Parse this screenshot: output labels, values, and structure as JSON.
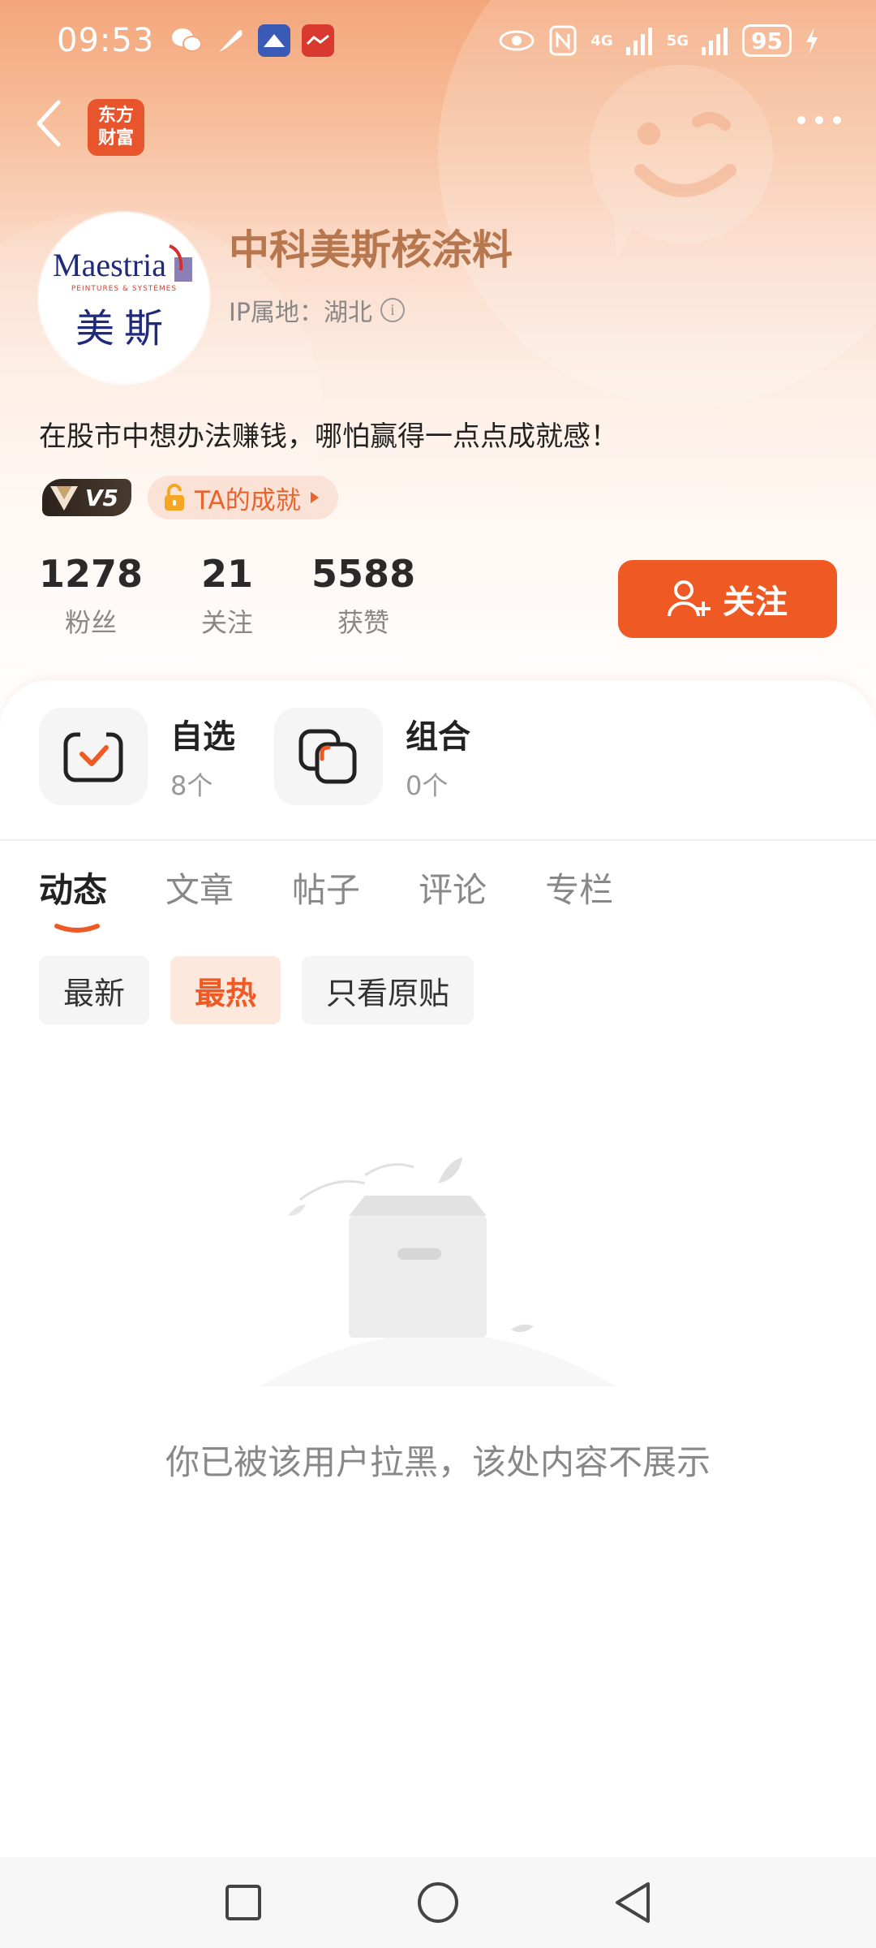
{
  "status_bar": {
    "time": "09:53",
    "battery": "95",
    "net1": "4G",
    "net2": "5G"
  },
  "nav": {
    "logo_line1": "东方",
    "logo_line2": "财富"
  },
  "profile": {
    "name": "中科美斯核涂料",
    "ip_location": "IP属地：湖北",
    "bio": "在股市中想办法赚钱，哪怕赢得一点点成就感！",
    "avatar_brand": "Maestria",
    "avatar_brand_sub": "PEINTURES & SYSTÈMES",
    "avatar_brand_cn": "美斯",
    "vip_level": "V5",
    "achievement_label": "TA的成就"
  },
  "stats": [
    {
      "value": "1278",
      "label": "粉丝"
    },
    {
      "value": "21",
      "label": "关注"
    },
    {
      "value": "5588",
      "label": "获赞"
    }
  ],
  "follow_button": "关注",
  "portfolio": {
    "watchlist": {
      "title": "自选",
      "count": "8个"
    },
    "combo": {
      "title": "组合",
      "count": "0个"
    }
  },
  "tabs": [
    "动态",
    "文章",
    "帖子",
    "评论",
    "专栏"
  ],
  "active_tab": 0,
  "filters": [
    "最新",
    "最热",
    "只看原贴"
  ],
  "active_filter": 1,
  "empty_message": "你已被该用户拉黑，该处内容不展示",
  "colors": {
    "accent": "#ef5a24",
    "name": "#b6774e",
    "header_top": "#f4a67a"
  }
}
